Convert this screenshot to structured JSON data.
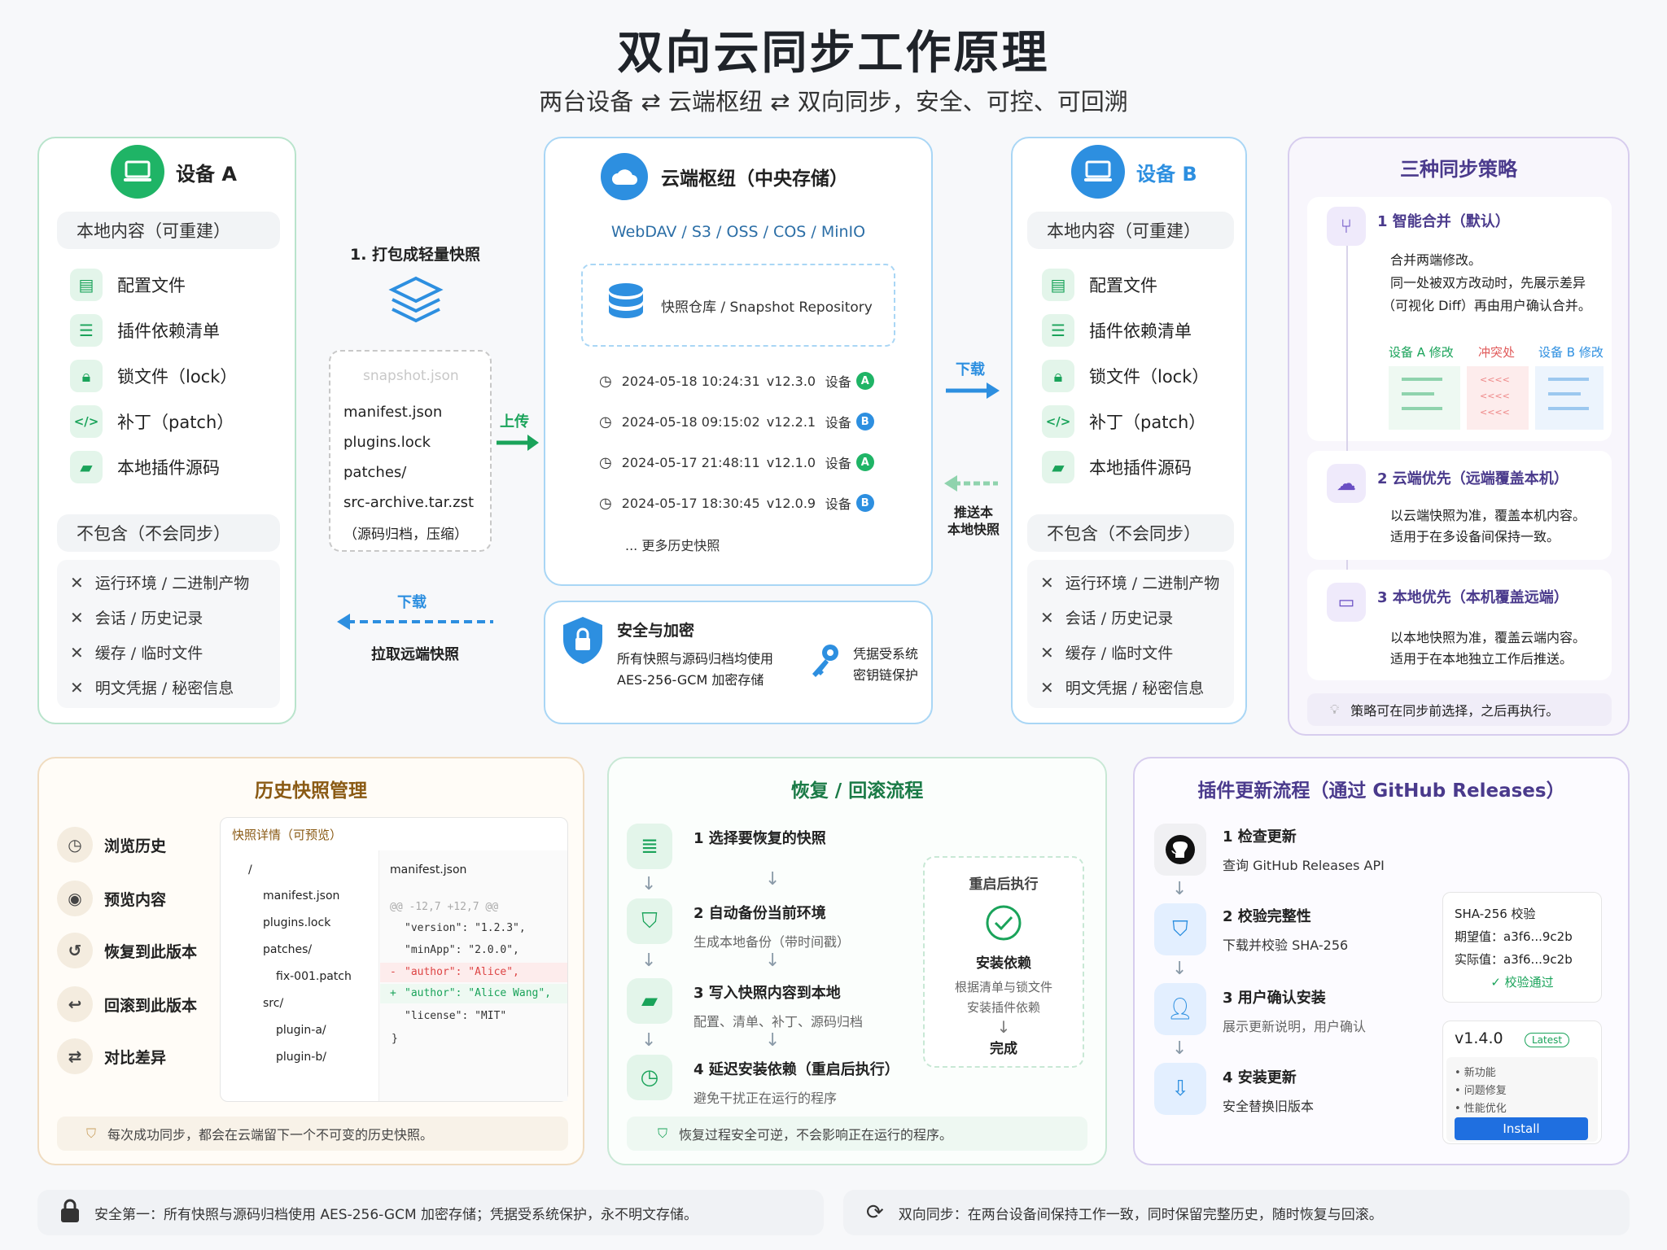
{
  "title": "双向云同步工作原理",
  "subtitle": "两台设备 ⇄ 云端枢纽 ⇄ 双向同步，安全、可控、可回溯",
  "deviceA": {
    "name": "设备 A",
    "include_label": "本地内容（可重建）",
    "items": [
      "配置文件",
      "插件依赖清单",
      "锁文件（lock）",
      "补丁（patch）",
      "本地插件源码"
    ],
    "exclude_label": "不包含（不会同步）",
    "excludes": [
      "运行环境 / 二进制产物",
      "会话 / 历史记录",
      "缓存 / 临时文件",
      "明文凭据 / 秘密信息"
    ]
  },
  "deviceB": {
    "name": "设备 B",
    "include_label": "本地内容（可重建）",
    "items": [
      "配置文件",
      "插件依赖清单",
      "锁文件（lock）",
      "补丁（patch）",
      "本地插件源码"
    ],
    "exclude_label": "不包含（不会同步）",
    "excludes": [
      "运行环境 / 二进制产物",
      "会话 / 历史记录",
      "缓存 / 临时文件",
      "明文凭据 / 秘密信息"
    ]
  },
  "package": {
    "title": "1. 打包成轻量快照",
    "file_title": "snapshot.json",
    "files": [
      "manifest.json",
      "plugins.lock",
      "patches/",
      "src-archive.tar.zst"
    ],
    "note": "（源码归档，压缩）",
    "upload": "上传",
    "download": "下载",
    "pull": "拉取远端快照"
  },
  "cloud": {
    "title": "云端枢纽（中央存储）",
    "providers": "WebDAV / S3 / OSS / COS / MinIO",
    "repo": "快照仓库 / Snapshot Repository",
    "snapshots": [
      {
        "time": "2024-05-18 10:24:31",
        "ver": "v12.3.0",
        "dev": "设备",
        "tag": "A"
      },
      {
        "time": "2024-05-18 09:15:02",
        "ver": "v12.2.1",
        "dev": "设备",
        "tag": "B"
      },
      {
        "time": "2024-05-17 21:48:11",
        "ver": "v12.1.0",
        "dev": "设备",
        "tag": "A"
      },
      {
        "time": "2024-05-17 18:30:45",
        "ver": "v12.0.9",
        "dev": "设备",
        "tag": "B"
      }
    ],
    "more": "... 更多历史快照",
    "download": "下载",
    "push": "推送本\n本地快照"
  },
  "security": {
    "title": "安全与加密",
    "desc1": "所有快照与源码归档均使用",
    "desc2": "AES-256-GCM 加密存储",
    "key1": "凭据受系统",
    "key2": "密钥链保护"
  },
  "strategies": {
    "title": "三种同步策略",
    "s1_title": "1  智能合并（默认）",
    "s1_d1": "合并两端修改。",
    "s1_d2": "同一处被双方改动时，先展示差异",
    "s1_d3": "（可视化 Diff）再由用户确认合并。",
    "col_a": "设备 A 修改",
    "col_c": "冲突处",
    "col_b": "设备 B 修改",
    "s2_title": "2  云端优先（远端覆盖本机）",
    "s2_d1": "以云端快照为准，覆盖本机内容。",
    "s2_d2": "适用于在多设备间保持一致。",
    "s3_title": "3  本地优先（本机覆盖远端）",
    "s3_d1": "以本地快照为准，覆盖云端内容。",
    "s3_d2": "适用于在本地独立工作后推送。",
    "tip": "策略可在同步前选择，之后再执行。"
  },
  "history": {
    "title": "历史快照管理",
    "actions": [
      "浏览历史",
      "预览内容",
      "恢复到此版本",
      "回滚到此版本",
      "对比差异"
    ],
    "preview_title": "快照详情（可预览）",
    "tree": [
      "/",
      "manifest.json",
      "plugins.lock",
      "patches/",
      "fix-001.patch",
      "src/",
      "plugin-a/",
      "plugin-b/"
    ],
    "file": "manifest.json",
    "hunk": "@@ -12,7 +12,7 @@",
    "code": [
      "\"version\": \"1.2.3\",",
      "\"minApp\": \"2.0.0\",",
      "\"author\": \"Alice\",",
      "\"author\": \"Alice Wang\",",
      "\"license\": \"MIT\"",
      "}"
    ],
    "footer": "每次成功同步，都会在云端留下一个不可变的历史快照。"
  },
  "restore": {
    "title": "恢复 / 回滚流程",
    "steps": [
      {
        "h": "1 选择要恢复的快照",
        "d": ""
      },
      {
        "h": "2 自动备份当前环境",
        "d": "生成本地备份（带时间戳）"
      },
      {
        "h": "3 写入快照内容到本地",
        "d": "配置、清单、补丁、源码归档"
      },
      {
        "h": "4 延迟安装依赖（重启后执行）",
        "d": "避免干扰正在运行的程序"
      }
    ],
    "side_title": "重启后执行",
    "side_h": "安装依赖",
    "side_d1": "根据清单与锁文件",
    "side_d2": "安装插件依赖",
    "side_done": "完成",
    "footer": "恢复过程安全可逆，不会影响正在运行的程序。"
  },
  "plugin": {
    "title": "插件更新流程（通过 GitHub Releases）",
    "steps": [
      {
        "h": "1 检查更新",
        "d": "查询 GitHub Releases API"
      },
      {
        "h": "2 校验完整性",
        "d": "下载并校验 SHA-256"
      },
      {
        "h": "3 用户确认安装",
        "d": "展示更新说明，用户确认"
      },
      {
        "h": "4 安装更新",
        "d": "安全替换旧版本"
      }
    ],
    "sha_title": "SHA-256 校验",
    "sha_expect": "期望值：a3f6...9c2b",
    "sha_actual": "实际值：a3f6...9c2b",
    "sha_ok": "✓ 校验通过",
    "version": "v1.4.0",
    "latest": "Latest",
    "notes": [
      "• 新功能",
      "• 问题修复",
      "• 性能优化"
    ],
    "install": "Install"
  },
  "footer": {
    "left": "安全第一：所有快照与源码归档使用 AES-256-GCM 加密存储；凭据受系统保护，永不明文存储。",
    "right": "双向同步：在两台设备间保持工作一致，同时保留完整历史，随时恢复与回滚。"
  }
}
